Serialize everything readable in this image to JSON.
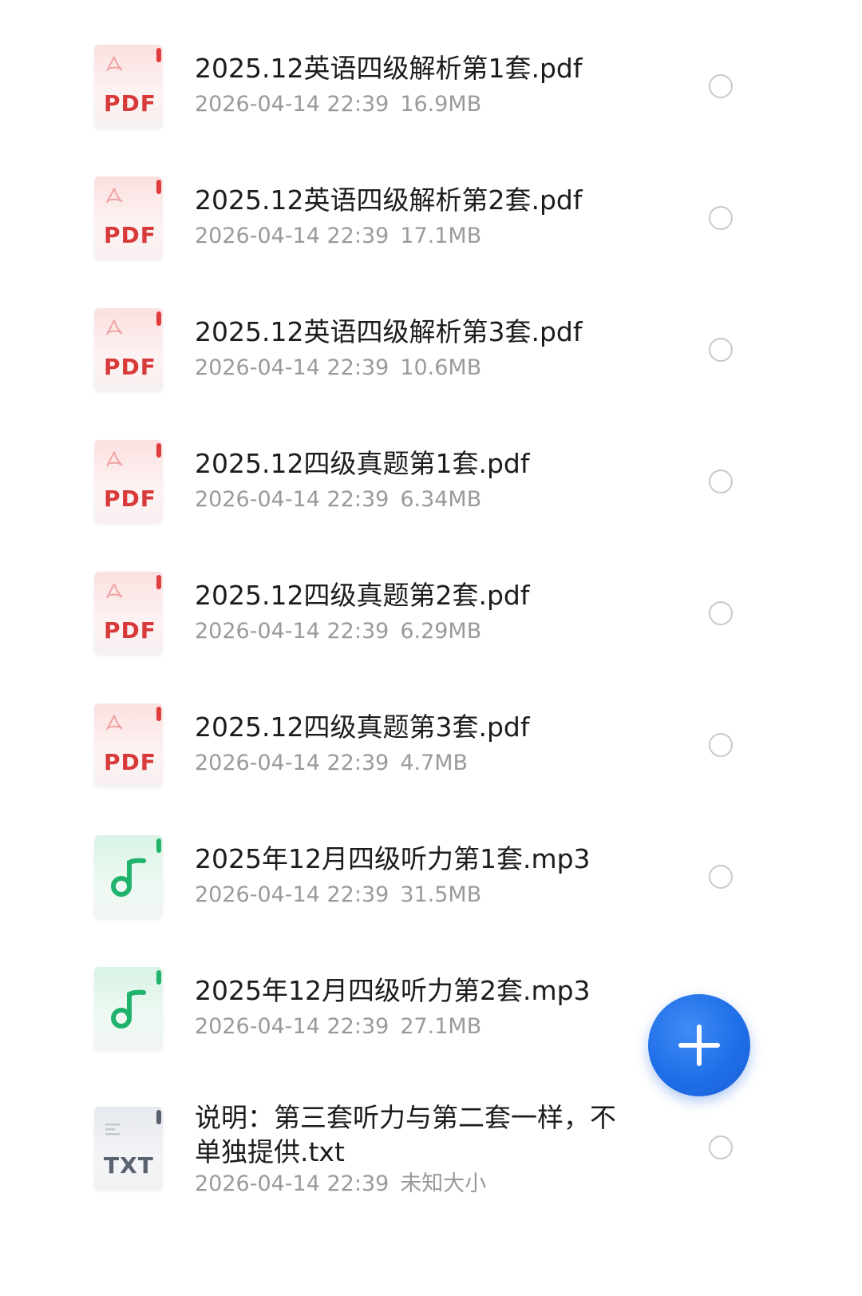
{
  "files": [
    {
      "name": "2025.12英语四级解析第1套.pdf",
      "date": "2026-04-14 22:39",
      "size": "16.9MB",
      "type": "pdf",
      "type_label": "PDF",
      "icon": "pdf-file-icon"
    },
    {
      "name": "2025.12英语四级解析第2套.pdf",
      "date": "2026-04-14 22:39",
      "size": "17.1MB",
      "type": "pdf",
      "type_label": "PDF",
      "icon": "pdf-file-icon"
    },
    {
      "name": "2025.12英语四级解析第3套.pdf",
      "date": "2026-04-14 22:39",
      "size": "10.6MB",
      "type": "pdf",
      "type_label": "PDF",
      "icon": "pdf-file-icon"
    },
    {
      "name": "2025.12四级真题第1套.pdf",
      "date": "2026-04-14 22:39",
      "size": "6.34MB",
      "type": "pdf",
      "type_label": "PDF",
      "icon": "pdf-file-icon"
    },
    {
      "name": "2025.12四级真题第2套.pdf",
      "date": "2026-04-14 22:39",
      "size": "6.29MB",
      "type": "pdf",
      "type_label": "PDF",
      "icon": "pdf-file-icon"
    },
    {
      "name": "2025.12四级真题第3套.pdf",
      "date": "2026-04-14 22:39",
      "size": "4.7MB",
      "type": "pdf",
      "type_label": "PDF",
      "icon": "pdf-file-icon"
    },
    {
      "name": "2025年12月四级听力第1套.mp3",
      "date": "2026-04-14 22:39",
      "size": "31.5MB",
      "type": "mp3",
      "type_label": "",
      "icon": "music-note-icon"
    },
    {
      "name": "2025年12月四级听力第2套.mp3",
      "date": "2026-04-14 22:39",
      "size": "27.1MB",
      "type": "mp3",
      "type_label": "",
      "icon": "music-note-icon"
    },
    {
      "name": "说明：第三套听力与第二套一样，不单独提供.txt",
      "date": "2026-04-14 22:39",
      "size": "未知大小",
      "type": "txt",
      "type_label": "TXT",
      "icon": "text-file-icon"
    }
  ],
  "fab": {
    "icon": "plus-icon"
  },
  "colors": {
    "pdf_red": "#d83a3a",
    "mp3_green": "#1fb36b",
    "txt_gray": "#5b6270",
    "fab_blue": "#1f6fe8",
    "meta_gray": "#9a9a9a"
  }
}
